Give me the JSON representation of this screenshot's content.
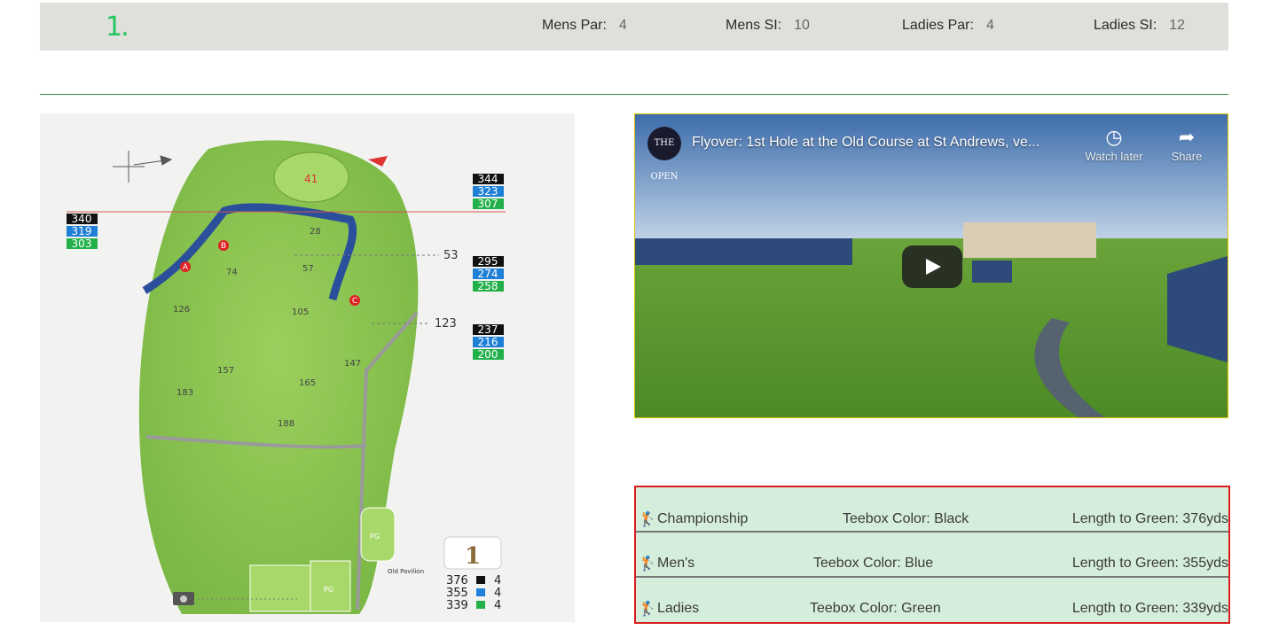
{
  "hole": {
    "number": "1.",
    "stats": [
      {
        "label": "Mens Par:",
        "value": "4"
      },
      {
        "label": "Mens SI:",
        "value": "10"
      },
      {
        "label": "Ladies Par:",
        "value": "4"
      },
      {
        "label": "Ladies SI:",
        "value": "12"
      }
    ]
  },
  "map": {
    "hole_badge": "1",
    "left_yardages": [
      "340",
      "319",
      "303"
    ],
    "right_top_yardages": [
      "344",
      "323",
      "307"
    ],
    "right_mid_yardages": [
      "295",
      "274",
      "258"
    ],
    "right_low_yardages": [
      "237",
      "216",
      "200"
    ],
    "green_number": "41",
    "distance_labels": {
      "d53": "53",
      "d123": "123"
    },
    "distance_points": [
      "28",
      "57",
      "74",
      "105",
      "126",
      "147",
      "157",
      "165",
      "183",
      "188"
    ],
    "hazard_letters": [
      "A",
      "B",
      "C"
    ],
    "pavilion_label": "Old Pavilion",
    "pg_label": "PG",
    "tee_legend": [
      {
        "yards": "376",
        "par": "4",
        "color": "#111111"
      },
      {
        "yards": "355",
        "par": "4",
        "color": "#1e7fd6"
      },
      {
        "yards": "339",
        "par": "4",
        "color": "#22b04a"
      }
    ],
    "tag_colors": {
      "black": "#111111",
      "blue": "#1e7fd6",
      "green": "#22b04a"
    }
  },
  "video": {
    "logo_text": "THE OPEN",
    "title": "Flyover: 1st Hole at the Old Course at St Andrews, ve...",
    "watch_later": "Watch later",
    "share": "Share"
  },
  "tees": [
    {
      "name": "Championship",
      "color_text": "Teebox Color: Black",
      "length_text": "Length to Green: 376yds"
    },
    {
      "name": "Men's",
      "color_text": "Teebox Color: Blue",
      "length_text": "Length to Green: 355yds"
    },
    {
      "name": "Ladies",
      "color_text": "Teebox Color: Green",
      "length_text": "Length to Green: 339yds"
    }
  ]
}
